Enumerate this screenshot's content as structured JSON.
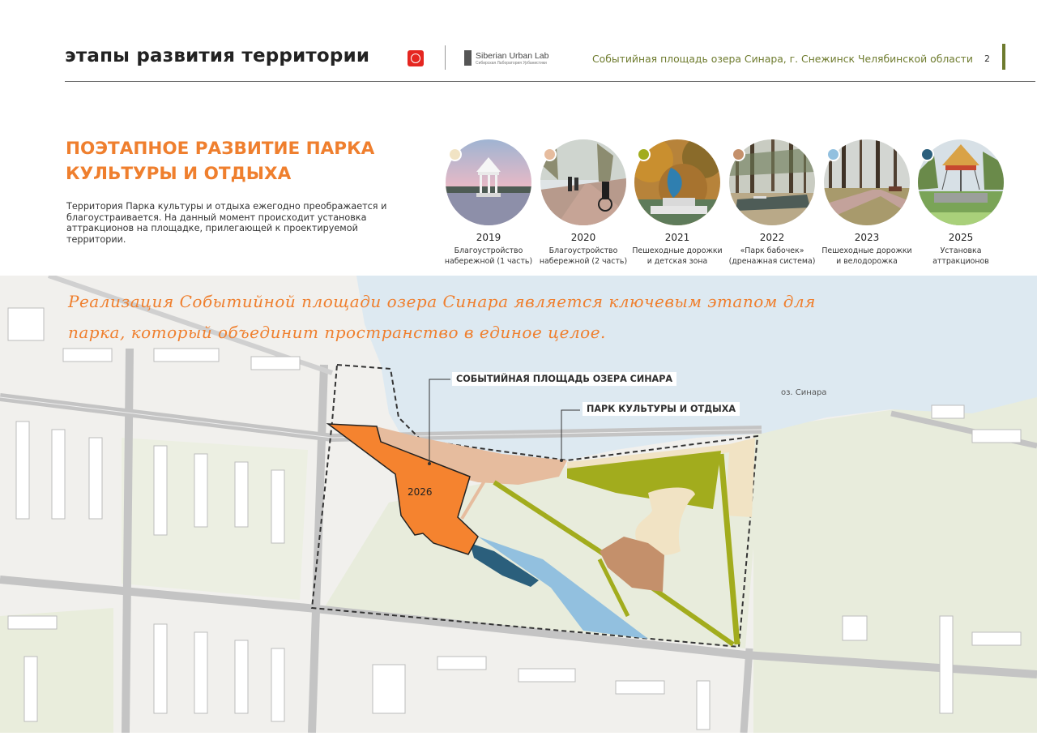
{
  "header": {
    "heading": "этапы развития территории",
    "logo_name": "Siberian Urban Lab",
    "logo_subtitle": "Сибирская Лаборатория Урбанистики",
    "project_title": "Событийная площадь озера Синара, г. Снежинск Челябинской области",
    "page_number": "2"
  },
  "section": {
    "title_line1": "ПОЭТАПНОЕ РАЗВИТИЕ ПАРКА",
    "title_line2": "КУЛЬТУРЫ И ОТДЫХА",
    "intro": "Территория Парка культуры и отдыха ежегодно преображается и благоустраивается. На данный момент происходит установка аттракционов на площадке, прилегающей к проектируемой территории."
  },
  "stages": [
    {
      "year": "2019",
      "line1": "Благоустройство",
      "line2": "набережной (1 часть)",
      "color": "#f1e3c4",
      "icon": "gazebo-photo"
    },
    {
      "year": "2020",
      "line1": "Благоустройство",
      "line2": "набережной (2 часть)",
      "color": "#e6bc9e",
      "icon": "promenade-photo"
    },
    {
      "year": "2021",
      "line1": "Пешеходные дорожки",
      "line2": "и детская зона",
      "color": "#a2ac1d",
      "icon": "sculpture-photo"
    },
    {
      "year": "2022",
      "line1": "«Парк бабочек»",
      "line2": "(дренажная система)",
      "color": "#c4906b",
      "icon": "forest-pond-photo"
    },
    {
      "year": "2023",
      "line1": "Пешеходные дорожки",
      "line2": "и велодорожка",
      "color": "#92c0df",
      "icon": "forest-path-photo"
    },
    {
      "year": "2025",
      "line1": "Установка",
      "line2": "аттракционов",
      "color": "#2b5f7c",
      "icon": "carousel-photo"
    }
  ],
  "map": {
    "script_line1": "Реализация Событийной площади озера Синара является ключевым этапом для",
    "script_line2": "парка, который объединит пространство в единое целое.",
    "callout_event": "СОБЫТИЙНАЯ ПЛОЩАДЬ ОЗЕРА СИНАРА",
    "callout_park": "ПАРК КУЛЬТУРЫ И ОТДЫХА",
    "lake_label": "оз. Синара",
    "zone_year": "2026",
    "colors": {
      "event_square": "#f5832f",
      "lake": "#dde9f1",
      "park_green": "#a2ac1d",
      "embankment": "#e6bc9e"
    }
  }
}
